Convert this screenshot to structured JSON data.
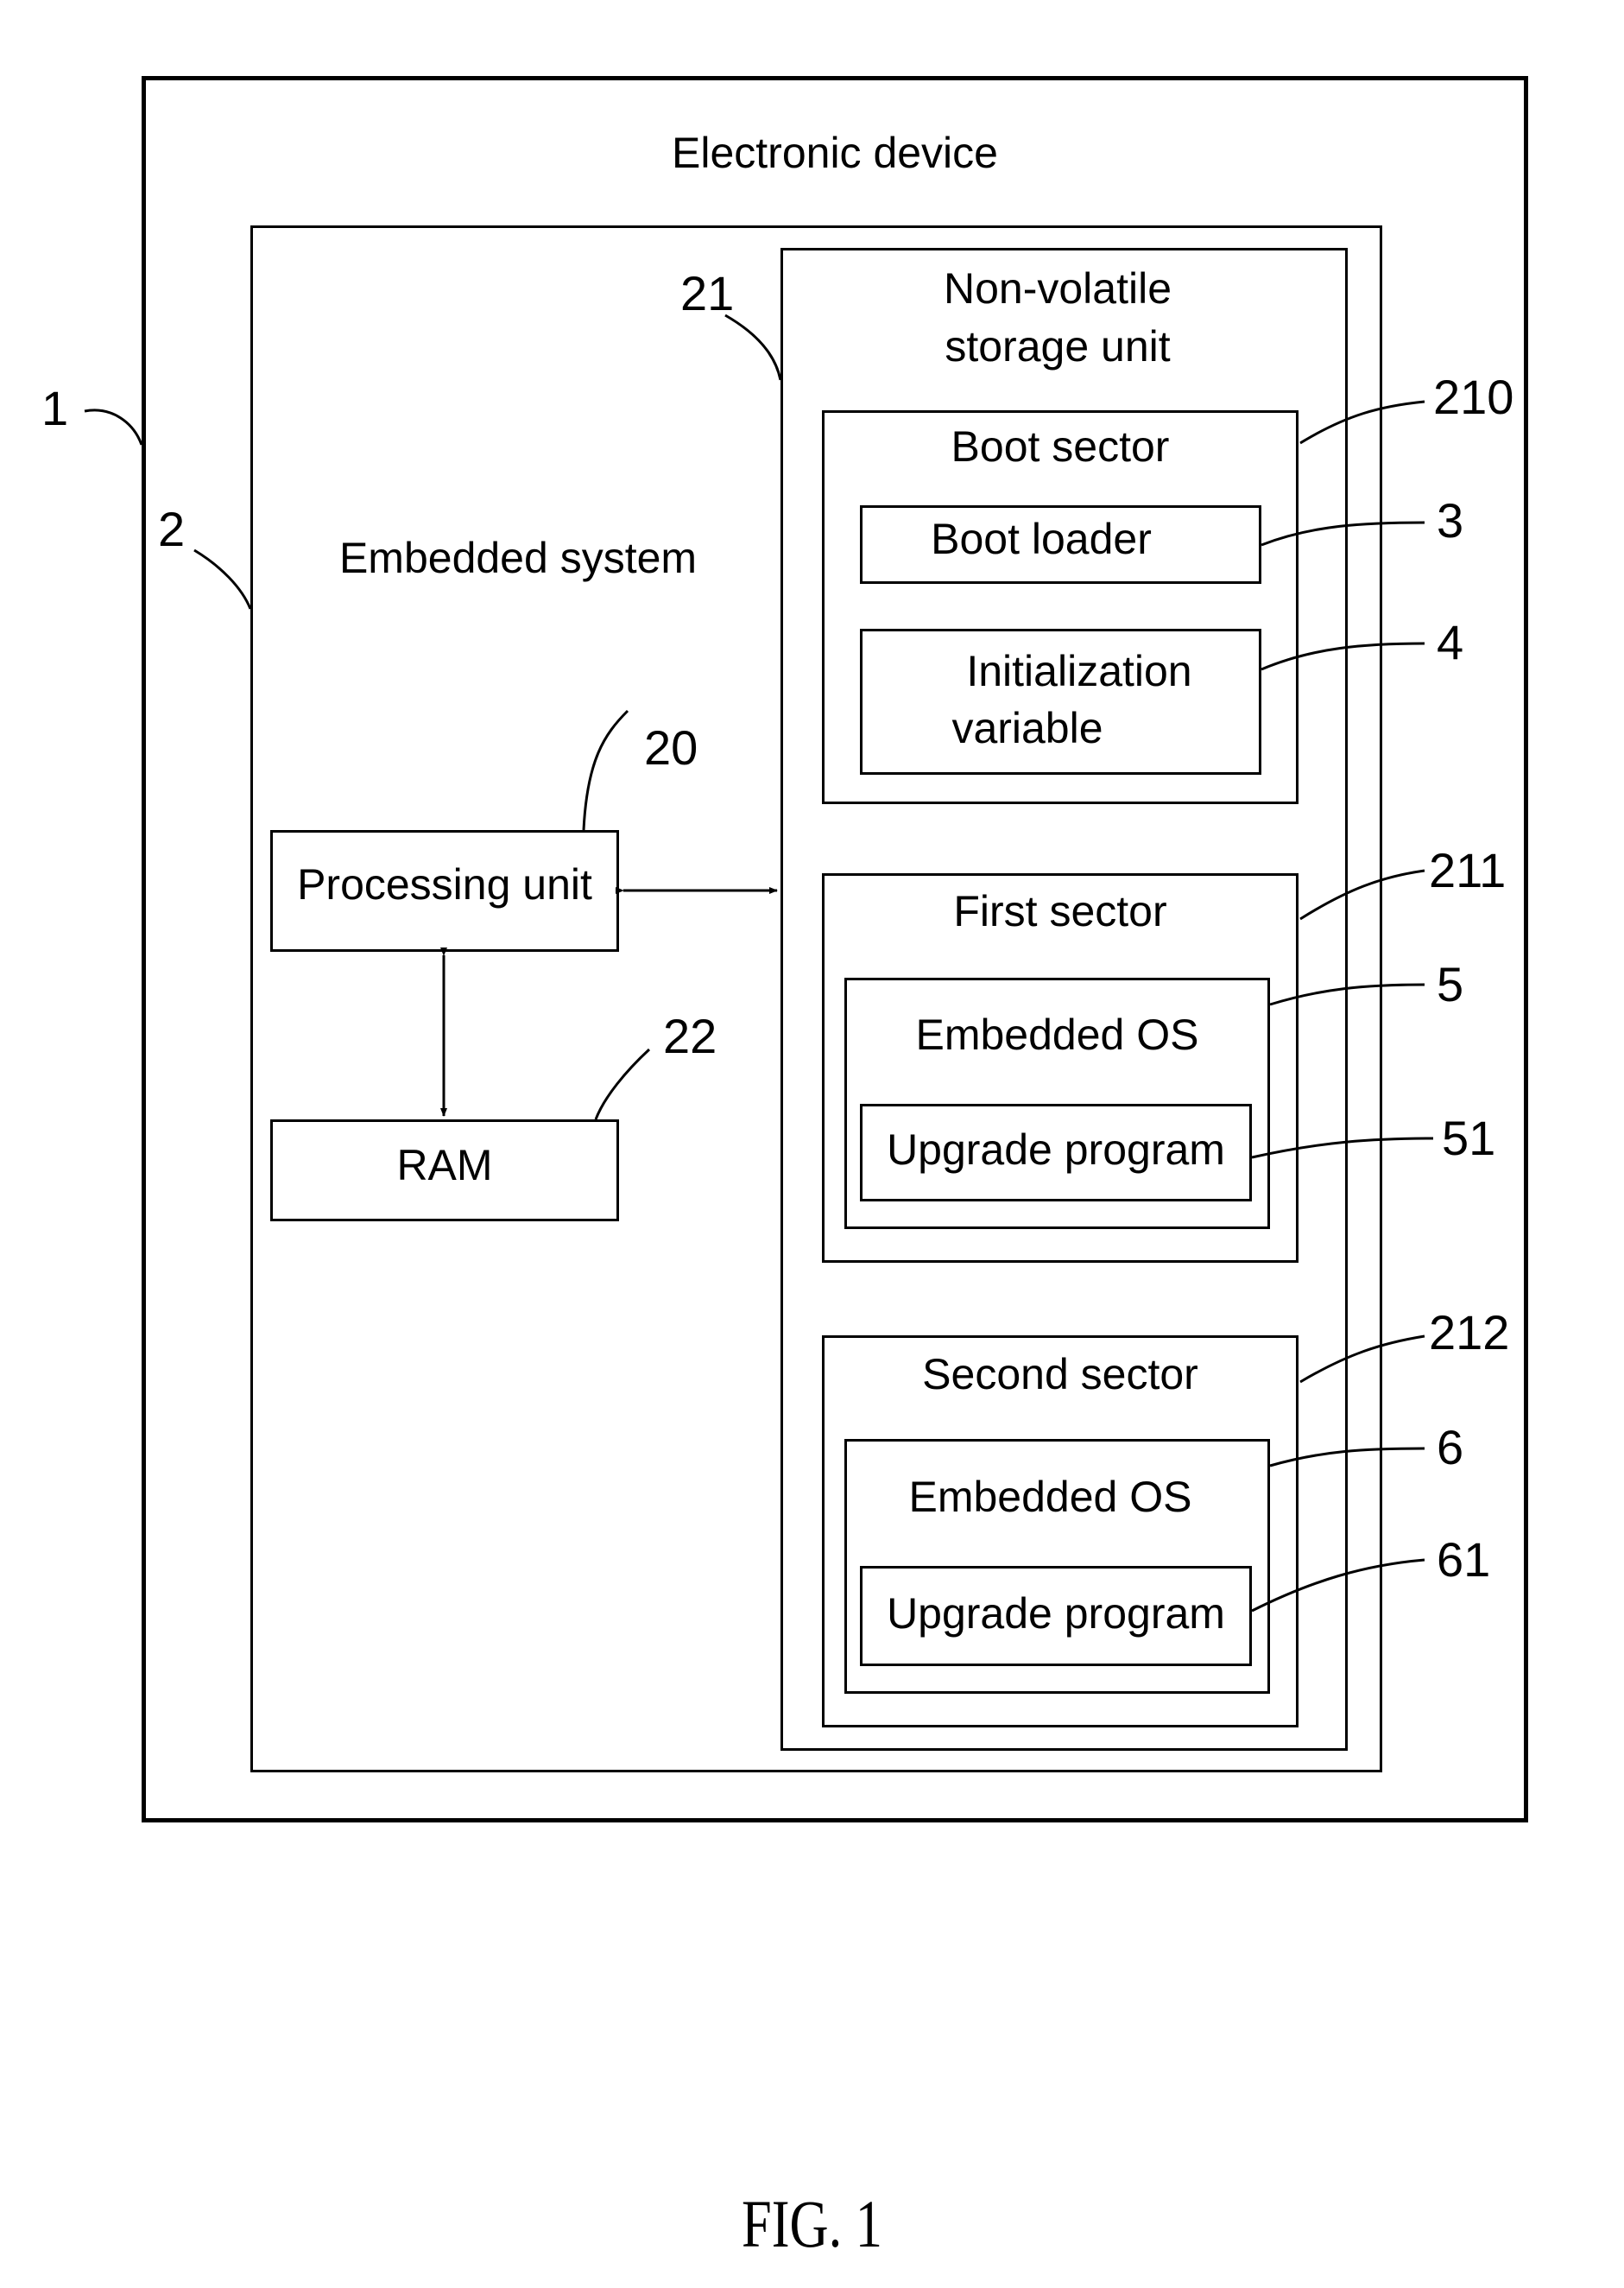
{
  "figure_label": "FIG. 1",
  "device": {
    "ref": "1",
    "label": "Electronic device"
  },
  "embedded_system": {
    "ref": "2",
    "label": "Embedded system"
  },
  "processing_unit": {
    "ref": "20",
    "label": "Processing unit"
  },
  "ram": {
    "ref": "22",
    "label": "RAM"
  },
  "storage": {
    "ref": "21",
    "label_line1": "Non-volatile",
    "label_line2": "storage unit"
  },
  "boot_sector": {
    "ref": "210",
    "label": "Boot sector"
  },
  "boot_loader": {
    "ref": "3",
    "label": "Boot loader"
  },
  "init_variable": {
    "ref": "4",
    "label_line1": "Initialization",
    "label_line2": "variable"
  },
  "first_sector": {
    "ref": "211",
    "label": "First sector"
  },
  "os_first": {
    "ref": "5",
    "label": "Embedded OS"
  },
  "upgrade_first": {
    "ref": "51",
    "label": "Upgrade program"
  },
  "second_sector": {
    "ref": "212",
    "label": "Second sector"
  },
  "os_second": {
    "ref": "6",
    "label": "Embedded OS"
  },
  "upgrade_second": {
    "ref": "61",
    "label": "Upgrade program"
  }
}
